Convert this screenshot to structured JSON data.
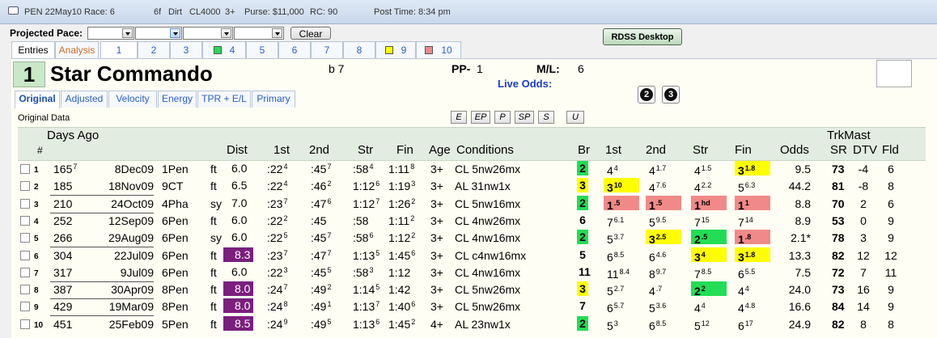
{
  "titlebar": {
    "race": "PEN 22May10 Race: 6",
    "distance": "6f",
    "surface": "Dirt",
    "class": "CL4000",
    "age": "3+",
    "purse": "Purse: $11,000",
    "rc": "RC: 90",
    "post_time": "Post Time: 8:34 pm"
  },
  "pace": {
    "label": "Projected Pace:",
    "clear_label": "Clear",
    "rdss_label": "RDSS Desktop"
  },
  "tabs": {
    "entries": "Entries",
    "analysis": "Analysis",
    "numbers": [
      "1",
      "2",
      "3",
      "4",
      "5",
      "6",
      "7",
      "8",
      "9",
      "10"
    ],
    "swatch_colors": {
      "4": "#22dd55",
      "9": "#ffff00",
      "10": "#f08a88"
    }
  },
  "horse": {
    "pp_number": "1",
    "name": "Star Commando",
    "color_age": "b 7",
    "pp_label": "PP-",
    "pp_value": "1",
    "ml_label": "M/L:",
    "ml_value": "6",
    "live_odds_label": "Live Odds:",
    "btn2": "2",
    "btn3": "3"
  },
  "subtabs": [
    "Original",
    "Adjusted",
    "Velocity",
    "Energy",
    "TPR + E/L",
    "Primary"
  ],
  "original_data_label": "Original Data",
  "mode_buttons": [
    "E",
    "EP",
    "P",
    "SP",
    "S",
    "U"
  ],
  "columns": {
    "days_ago": "Days Ago",
    "num": "#",
    "dist": "Dist",
    "first": "1st",
    "second": "2nd",
    "str": "Str",
    "fin": "Fin",
    "age": "Age",
    "conditions": "Conditions",
    "br": "Br",
    "first2": "1st",
    "second2": "2nd",
    "str2": "Str",
    "fin2": "Fin",
    "odds": "Odds",
    "trkmast": "TrkMast",
    "sr": "SR",
    "dtv": "DTV",
    "fld": "Fld"
  },
  "rows": [
    {
      "n": "1",
      "days": "165",
      "days_sup": "7",
      "date": "8Dec09",
      "track": "1Pen",
      "cond": "ft",
      "dist": "6.0",
      "c1": ":22",
      "c1s": "4",
      "c2": ":45",
      "c2s": "7",
      "c3": ":58",
      "c3s": "4",
      "c4": "1:11",
      "c4s": "8",
      "age": "3+",
      "conditions": "CL 5nw26mx",
      "br": "2",
      "p1": "4",
      "p1s": "4",
      "p2": "4",
      "p2s": "1.7",
      "p3": "4",
      "p3s": "1.5",
      "p4": "3",
      "p4s": "1.8",
      "odds": "9.5",
      "sr": "73",
      "dtv": "-4",
      "fld": "6"
    },
    {
      "n": "2",
      "days": "185",
      "days_sup": "",
      "date": "18Nov09",
      "track": "9CT",
      "cond": "ft",
      "dist": "6.5",
      "c1": ":22",
      "c1s": "4",
      "c2": ":46",
      "c2s": "2",
      "c3": "1:12",
      "c3s": "6",
      "c4": "1:19",
      "c4s": "3",
      "age": "3+",
      "conditions": "AL 31nw1x",
      "br": "3",
      "p1": "3",
      "p1s": "10",
      "p2": "4",
      "p2s": "7.6",
      "p3": "4",
      "p3s": "2.2",
      "p4": "5",
      "p4s": "6.3",
      "odds": "44.2",
      "sr": "81",
      "dtv": "-8",
      "fld": "8"
    },
    {
      "n": "3",
      "days": "210",
      "days_sup": "",
      "date": "24Oct09",
      "track": "4Pha",
      "cond": "sy",
      "dist": "7.0",
      "c1": ":23",
      "c1s": "7",
      "c2": ":47",
      "c2s": "6",
      "c3": "1:12",
      "c3s": "7",
      "c4": "1:26",
      "c4s": "2",
      "age": "3+",
      "conditions": "CL 5nw16mx",
      "br": "2",
      "p1": "1",
      "p1s": ".5",
      "p2": "1",
      "p2s": ".5",
      "p3": "1",
      "p3s": "hd",
      "p4": "1",
      "p4s": "1",
      "odds": "8.8",
      "sr": "70",
      "dtv": "2",
      "fld": "6"
    },
    {
      "n": "4",
      "days": "252",
      "days_sup": "",
      "date": "12Sep09",
      "track": "6Pen",
      "cond": "ft",
      "dist": "6.0",
      "c1": ":22",
      "c1s": "2",
      "c2": ":45",
      "c2s": "",
      "c3": ":58",
      "c3s": "",
      "c4": "1:11",
      "c4s": "2",
      "age": "3+",
      "conditions": "CL 4nw26mx",
      "br": "6",
      "p1": "7",
      "p1s": "6.1",
      "p2": "5",
      "p2s": "9.5",
      "p3": "7",
      "p3s": "15",
      "p4": "7",
      "p4s": "14",
      "odds": "8.9",
      "sr": "53",
      "dtv": "0",
      "fld": "9"
    },
    {
      "n": "5",
      "days": "266",
      "days_sup": "",
      "date": "29Aug09",
      "track": "6Pen",
      "cond": "sy",
      "dist": "6.0",
      "c1": ":22",
      "c1s": "5",
      "c2": ":45",
      "c2s": "7",
      "c3": ":58",
      "c3s": "6",
      "c4": "1:12",
      "c4s": "2",
      "age": "3+",
      "conditions": "CL 4nw16mx",
      "br": "2",
      "p1": "5",
      "p1s": "3.7",
      "p2": "3",
      "p2s": "2.5",
      "p3": "2",
      "p3s": ".5",
      "p4": "1",
      "p4s": ".8",
      "odds": "2.1*",
      "sr": "78",
      "dtv": "3",
      "fld": "9"
    },
    {
      "n": "6",
      "days": "304",
      "days_sup": "",
      "date": "22Jul09",
      "track": "6Pen",
      "cond": "ft",
      "dist": "8.3",
      "c1": ":23",
      "c1s": "7",
      "c2": ":47",
      "c2s": "7",
      "c3": "1:13",
      "c3s": "5",
      "c4": "1:45",
      "c4s": "6",
      "age": "3+",
      "conditions": "CL c4nw16mx",
      "br": "5",
      "p1": "6",
      "p1s": "8.5",
      "p2": "6",
      "p2s": "4.6",
      "p3": "3",
      "p3s": "4",
      "p4": "3",
      "p4s": "1.8",
      "odds": "13.3",
      "sr": "82",
      "dtv": "12",
      "fld": "12"
    },
    {
      "n": "7",
      "days": "317",
      "days_sup": "",
      "date": "9Jul09",
      "track": "6Pen",
      "cond": "ft",
      "dist": "6.0",
      "c1": ":22",
      "c1s": "3",
      "c2": ":45",
      "c2s": "5",
      "c3": ":58",
      "c3s": "3",
      "c4": "1:12",
      "c4s": "",
      "age": "3+",
      "conditions": "CL 4nw16mx",
      "br": "11",
      "p1": "11",
      "p1s": "8.4",
      "p2": "8",
      "p2s": "9.7",
      "p3": "7",
      "p3s": "8.5",
      "p4": "6",
      "p4s": "5.5",
      "odds": "7.5",
      "sr": "72",
      "dtv": "7",
      "fld": "11"
    },
    {
      "n": "8",
      "days": "387",
      "days_sup": "",
      "date": "30Apr09",
      "track": "8Pen",
      "cond": "ft",
      "dist": "8.0",
      "c1": ":24",
      "c1s": "7",
      "c2": ":49",
      "c2s": "2",
      "c3": "1:14",
      "c3s": "5",
      "c4": "1:42",
      "c4s": "",
      "age": "3+",
      "conditions": "CL 5nw26mx",
      "br": "3",
      "p1": "5",
      "p1s": "2.7",
      "p2": "4",
      "p2s": ".7",
      "p3": "2",
      "p3s": "2",
      "p4": "4",
      "p4s": "4",
      "odds": "24.0",
      "sr": "73",
      "dtv": "16",
      "fld": "9"
    },
    {
      "n": "9",
      "days": "429",
      "days_sup": "",
      "date": "19Mar09",
      "track": "8Pen",
      "cond": "ft",
      "dist": "8.0",
      "c1": ":24",
      "c1s": "8",
      "c2": ":49",
      "c2s": "1",
      "c3": "1:13",
      "c3s": "7",
      "c4": "1:40",
      "c4s": "6",
      "age": "3+",
      "conditions": "CL 5nw26mx",
      "br": "7",
      "p1": "6",
      "p1s": "5.7",
      "p2": "5",
      "p2s": "3.6",
      "p3": "4",
      "p3s": "4",
      "p4": "4",
      "p4s": "4.8",
      "odds": "16.6",
      "sr": "84",
      "dtv": "14",
      "fld": "9"
    },
    {
      "n": "10",
      "days": "451",
      "days_sup": "",
      "date": "25Feb09",
      "track": "5Pen",
      "cond": "ft",
      "dist": "8.5",
      "c1": ":24",
      "c1s": "9",
      "c2": ":49",
      "c2s": "5",
      "c3": "1:13",
      "c3s": "6",
      "c4": "1:45",
      "c4s": "2",
      "age": "4+",
      "conditions": "AL 23nw1x",
      "br": "2",
      "p1": "5",
      "p1s": "3",
      "p2": "6",
      "p2s": "8.5",
      "p3": "5",
      "p3s": "12",
      "p4": "6",
      "p4s": "17",
      "odds": "24.9",
      "sr": "82",
      "dtv": "8",
      "fld": "8"
    }
  ]
}
